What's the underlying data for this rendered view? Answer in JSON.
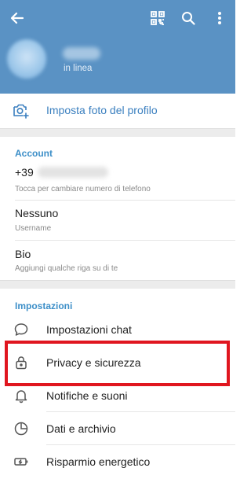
{
  "header": {
    "status": "in linea",
    "icons": [
      "back-arrow-icon",
      "qr-code-icon",
      "search-icon",
      "more-vertical-icon"
    ],
    "color": "#5a92c4"
  },
  "set_photo": {
    "label": "Imposta foto del profilo"
  },
  "account": {
    "title": "Account",
    "phone": {
      "value": "+39",
      "hint": "Tocca per cambiare numero di telefono"
    },
    "username": {
      "value": "Nessuno",
      "hint": "Username"
    },
    "bio": {
      "value": "Bio",
      "hint": "Aggiungi qualche riga su di te"
    }
  },
  "settings": {
    "title": "Impostazioni",
    "items": [
      {
        "label": "Impostazioni chat",
        "icon": "chat-bubble-icon"
      },
      {
        "label": "Privacy e sicurezza",
        "icon": "lock-icon"
      },
      {
        "label": "Notifiche e suoni",
        "icon": "bell-icon"
      },
      {
        "label": "Dati e archivio",
        "icon": "pie-chart-icon"
      },
      {
        "label": "Risparmio energetico",
        "icon": "battery-icon"
      }
    ]
  },
  "colors": {
    "accent": "#3d8fc8",
    "highlight": "#e0161f"
  }
}
